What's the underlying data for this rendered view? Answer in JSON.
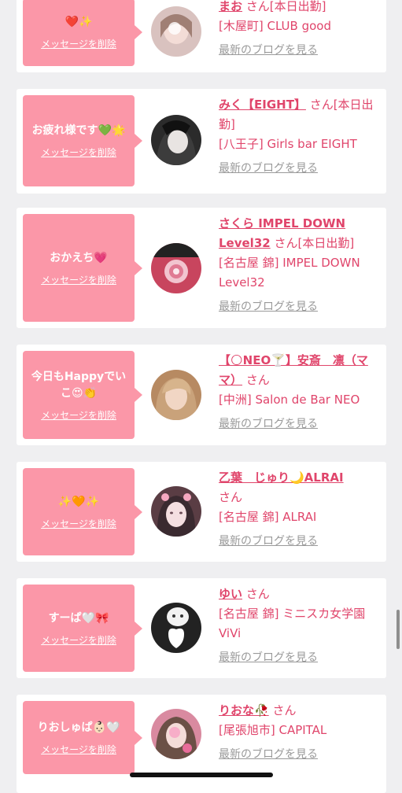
{
  "delete_label": "メッセージを削除",
  "blog_label": "最新のブログを見る",
  "cards": [
    {
      "message": "❤️✨",
      "name": "まお",
      "san": " さん[本日出勤]",
      "shop": "[木屋町] CLUB good",
      "avatar_color": "#d9c2bf"
    },
    {
      "message": "お疲れ様です💚🌟",
      "name": "みく【EIGHT】",
      "san": " さん[本日出勤]",
      "shop": "[八王子] Girls bar EIGHT",
      "avatar_color": "#2b2b2b"
    },
    {
      "message": "おかえち💗",
      "name": "さくら IMPEL DOWN Level32",
      "san": " さん[本日出勤]",
      "shop": "[名古屋 錦] IMPEL DOWN Level32",
      "avatar_color": "#c8455e"
    },
    {
      "message": "今日もHappyでいこ😍👏",
      "name": "【🌕NEO🍸】安斎　凛（ママ）",
      "san": " さん",
      "shop": "[中洲] Salon de Bar NEO",
      "avatar_color": "#b78a62"
    },
    {
      "message": "✨🧡✨",
      "name": "乙葉　じゅり🌙ALRAI",
      "san": " さん",
      "shop": "[名古屋 錦] ALRAI",
      "avatar_color": "#5a3d44"
    },
    {
      "message": "すーぱ🤍🎀",
      "name": "ゆい",
      "san": " さん",
      "shop": "[名古屋 錦] ミニスカ女学園ViVi",
      "avatar_color": "#222222"
    },
    {
      "message": "りおしゅぱ👶🏻🤍",
      "name": "りおな🥀",
      "san": " さん",
      "shop": "[尾張旭市] CAPITAL",
      "avatar_color": "#d98aa0"
    }
  ]
}
